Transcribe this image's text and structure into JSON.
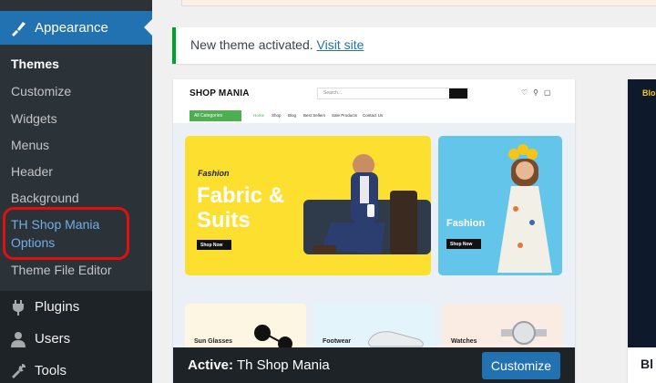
{
  "sidebar": {
    "active_item": {
      "label": "Appearance",
      "icon": "paintbrush-icon"
    },
    "submenu": [
      {
        "label": "Themes"
      },
      {
        "label": "Customize"
      },
      {
        "label": "Widgets"
      },
      {
        "label": "Menus"
      },
      {
        "label": "Header"
      },
      {
        "label": "Background"
      },
      {
        "label": "TH Shop Mania Options"
      },
      {
        "label": "Theme File Editor"
      }
    ],
    "menu": [
      {
        "label": "Plugins",
        "icon": "plugin-icon"
      },
      {
        "label": "Users",
        "icon": "user-icon"
      },
      {
        "label": "Tools",
        "icon": "wrench-icon"
      }
    ]
  },
  "notice": {
    "message": "New theme activated.",
    "link": "Visit site"
  },
  "theme_preview": {
    "logo": "SHOP MANIA",
    "search_placeholder": "Search...",
    "all_categories": "All Categories",
    "nav": [
      "Home",
      "Shop",
      "Blog",
      "Best Sellers",
      "Sale Products",
      "Contact Us"
    ],
    "hero_kicker": "Fashion",
    "hero_headline": "Fabric & Suits",
    "hero_button": "Shop Now",
    "side_headline": "Fashion",
    "side_button": "Shop Now",
    "categories": [
      "Sun Glasses",
      "Footwear",
      "Watches"
    ]
  },
  "theme_card": {
    "active_prefix": "Active:",
    "theme_name": "Th Shop Mania",
    "customize_label": "Customize"
  },
  "next_theme": {
    "preview_text": "Blo",
    "footer_text": "Bl"
  },
  "colors": {
    "sidebar_bg": "#1d2327",
    "submenu_bg": "#2c3338",
    "accent": "#2271b1",
    "notice_success": "#00a32a",
    "highlight_ring": "#e01010"
  }
}
